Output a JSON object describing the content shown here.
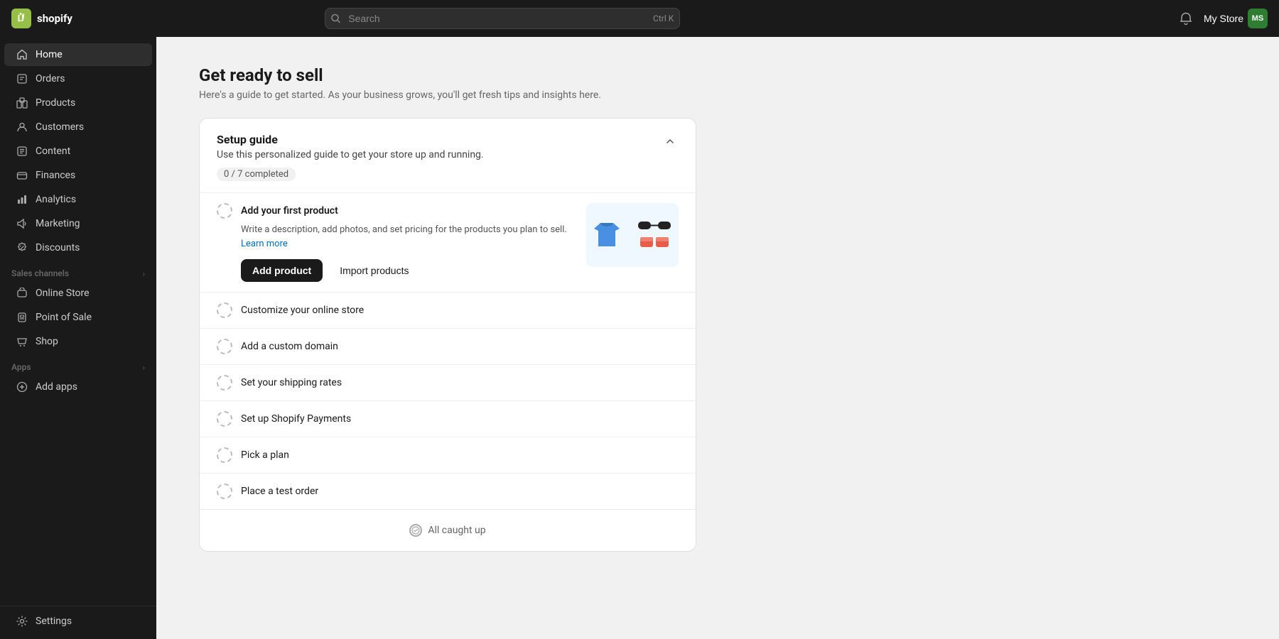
{
  "topnav": {
    "logo_text": "shopify",
    "search_placeholder": "Search",
    "search_shortcut": "Ctrl K",
    "bell_label": "Notifications",
    "store_name": "My Store",
    "store_avatar_initials": "MS"
  },
  "sidebar": {
    "nav_items": [
      {
        "id": "home",
        "label": "Home",
        "icon": "home-icon",
        "active": true
      },
      {
        "id": "orders",
        "label": "Orders",
        "icon": "orders-icon",
        "active": false
      },
      {
        "id": "products",
        "label": "Products",
        "icon": "products-icon",
        "active": false
      },
      {
        "id": "customers",
        "label": "Customers",
        "icon": "customers-icon",
        "active": false
      },
      {
        "id": "content",
        "label": "Content",
        "icon": "content-icon",
        "active": false
      },
      {
        "id": "finances",
        "label": "Finances",
        "icon": "finances-icon",
        "active": false
      },
      {
        "id": "analytics",
        "label": "Analytics",
        "icon": "analytics-icon",
        "active": false
      },
      {
        "id": "marketing",
        "label": "Marketing",
        "icon": "marketing-icon",
        "active": false
      },
      {
        "id": "discounts",
        "label": "Discounts",
        "icon": "discounts-icon",
        "active": false
      }
    ],
    "sales_channels_label": "Sales channels",
    "sales_channels": [
      {
        "id": "online-store",
        "label": "Online Store",
        "icon": "online-store-icon"
      },
      {
        "id": "point-of-sale",
        "label": "Point of Sale",
        "icon": "pos-icon"
      },
      {
        "id": "shop",
        "label": "Shop",
        "icon": "shop-icon"
      }
    ],
    "apps_label": "Apps",
    "apps_items": [
      {
        "id": "add-apps",
        "label": "Add apps",
        "icon": "add-icon"
      }
    ],
    "settings_label": "Settings",
    "settings_icon": "settings-icon"
  },
  "main": {
    "page_title": "Get ready to sell",
    "page_subtitle": "Here's a guide to get started. As your business grows, you'll get fresh tips and insights here.",
    "setup_guide": {
      "title": "Setup guide",
      "description": "Use this personalized guide to get your store up and running.",
      "progress": "0 / 7 completed",
      "items": [
        {
          "id": "add-product",
          "title": "Add your first product",
          "description": "Write a description, add photos, and set pricing for the products you plan to sell.",
          "learn_more_text": "Learn more",
          "expanded": true,
          "primary_btn": "Add product",
          "secondary_btn": "Import products"
        },
        {
          "id": "customize-store",
          "title": "Customize your online store",
          "expanded": false
        },
        {
          "id": "custom-domain",
          "title": "Add a custom domain",
          "expanded": false
        },
        {
          "id": "shipping-rates",
          "title": "Set your shipping rates",
          "expanded": false
        },
        {
          "id": "shopify-payments",
          "title": "Set up Shopify Payments",
          "expanded": false
        },
        {
          "id": "pick-plan",
          "title": "Pick a plan",
          "expanded": false
        },
        {
          "id": "test-order",
          "title": "Place a test order",
          "expanded": false
        }
      ]
    },
    "caught_up_text": "All caught up"
  }
}
